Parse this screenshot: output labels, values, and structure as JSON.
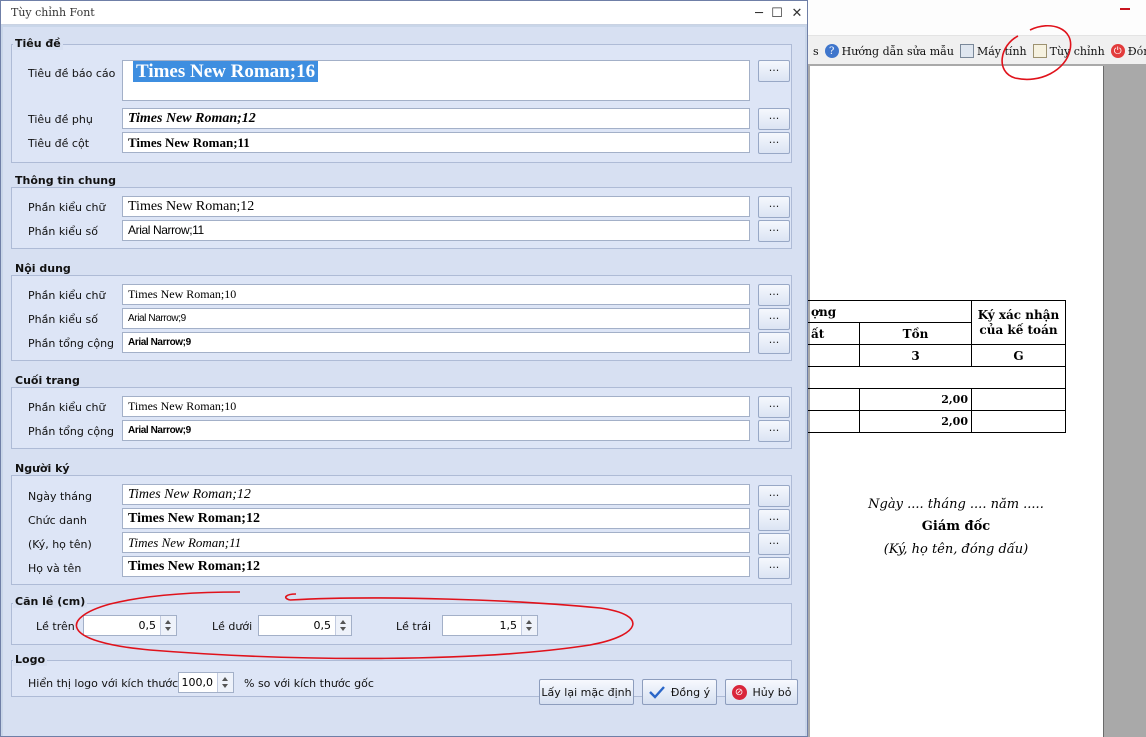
{
  "background": {
    "toolbar": [
      {
        "label": "s",
        "icon": ""
      },
      {
        "label": "Hướng dẫn sửa mẫu",
        "icon": "help-icon"
      },
      {
        "label": "Máy tính",
        "icon": "calculator-icon"
      },
      {
        "label": "Tùy chỉnh",
        "icon": "customize-icon"
      },
      {
        "label": "Đóng",
        "icon": "power-icon"
      }
    ],
    "report_table": {
      "header_1": "ợng",
      "header_sign": "Ký xác nhận của kế toán",
      "header_out": "ất",
      "header_stock": "Tồn",
      "col_code_3": "3",
      "col_code_g": "G",
      "row1_value": "2,00",
      "row2_value": "2,00"
    },
    "signature": {
      "date": "Ngày .... tháng .... năm .....",
      "title": "Giám đốc",
      "note": "(Ký, họ tên, đóng dấu)"
    }
  },
  "dialog": {
    "title": "Tùy chỉnh Font",
    "groups": {
      "title": {
        "label": "Tiêu đề",
        "rows": [
          {
            "label": "Tiêu đề báo cáo",
            "value": "Times New Roman;16"
          },
          {
            "label": "Tiêu đề phụ",
            "value": "Times New Roman;12"
          },
          {
            "label": "Tiêu đề cột",
            "value": "Times New Roman;11"
          }
        ]
      },
      "general": {
        "label": "Thông tin chung",
        "rows": [
          {
            "label": "Phần kiểu chữ",
            "value": "Times New Roman;12"
          },
          {
            "label": "Phần kiểu số",
            "value": "Arial Narrow;11"
          }
        ]
      },
      "content": {
        "label": "Nội dung",
        "rows": [
          {
            "label": "Phần kiểu chữ",
            "value": "Times New Roman;10"
          },
          {
            "label": "Phần kiểu số",
            "value": "Arial Narrow;9"
          },
          {
            "label": "Phần tổng cộng",
            "value": "Arial Narrow;9"
          }
        ]
      },
      "footer": {
        "label": "Cuối trang",
        "rows": [
          {
            "label": "Phần kiểu chữ",
            "value": "Times New Roman;10"
          },
          {
            "label": "Phần tổng cộng",
            "value": "Arial Narrow;9"
          }
        ]
      },
      "signer": {
        "label": "Người ký",
        "rows": [
          {
            "label": "Ngày tháng",
            "value": "Times New Roman;12"
          },
          {
            "label": "Chức danh",
            "value": "Times New Roman;12"
          },
          {
            "label": "(Ký, họ tên)",
            "value": "Times New Roman;11"
          },
          {
            "label": "Họ và tên",
            "value": "Times New Roman;12"
          }
        ]
      },
      "margin": {
        "label": "Căn lề (cm)",
        "top_label": "Lề trên",
        "top_value": "0,5",
        "bottom_label": "Lề dưới",
        "bottom_value": "0,5",
        "left_label": "Lề trái",
        "left_value": "1,5"
      },
      "logo": {
        "label": "Logo",
        "size_label": "Hiển thị logo với kích thước =",
        "size_value": "100,0",
        "suffix": "% so với kích thước gốc"
      }
    },
    "browse_label": "...",
    "buttons": {
      "reset": "Lấy lại mặc định",
      "ok": "Đồng ý",
      "cancel": "Hủy bỏ"
    }
  },
  "colors": {
    "annotation": "#e0121b",
    "selection": "#3e8ee0"
  }
}
